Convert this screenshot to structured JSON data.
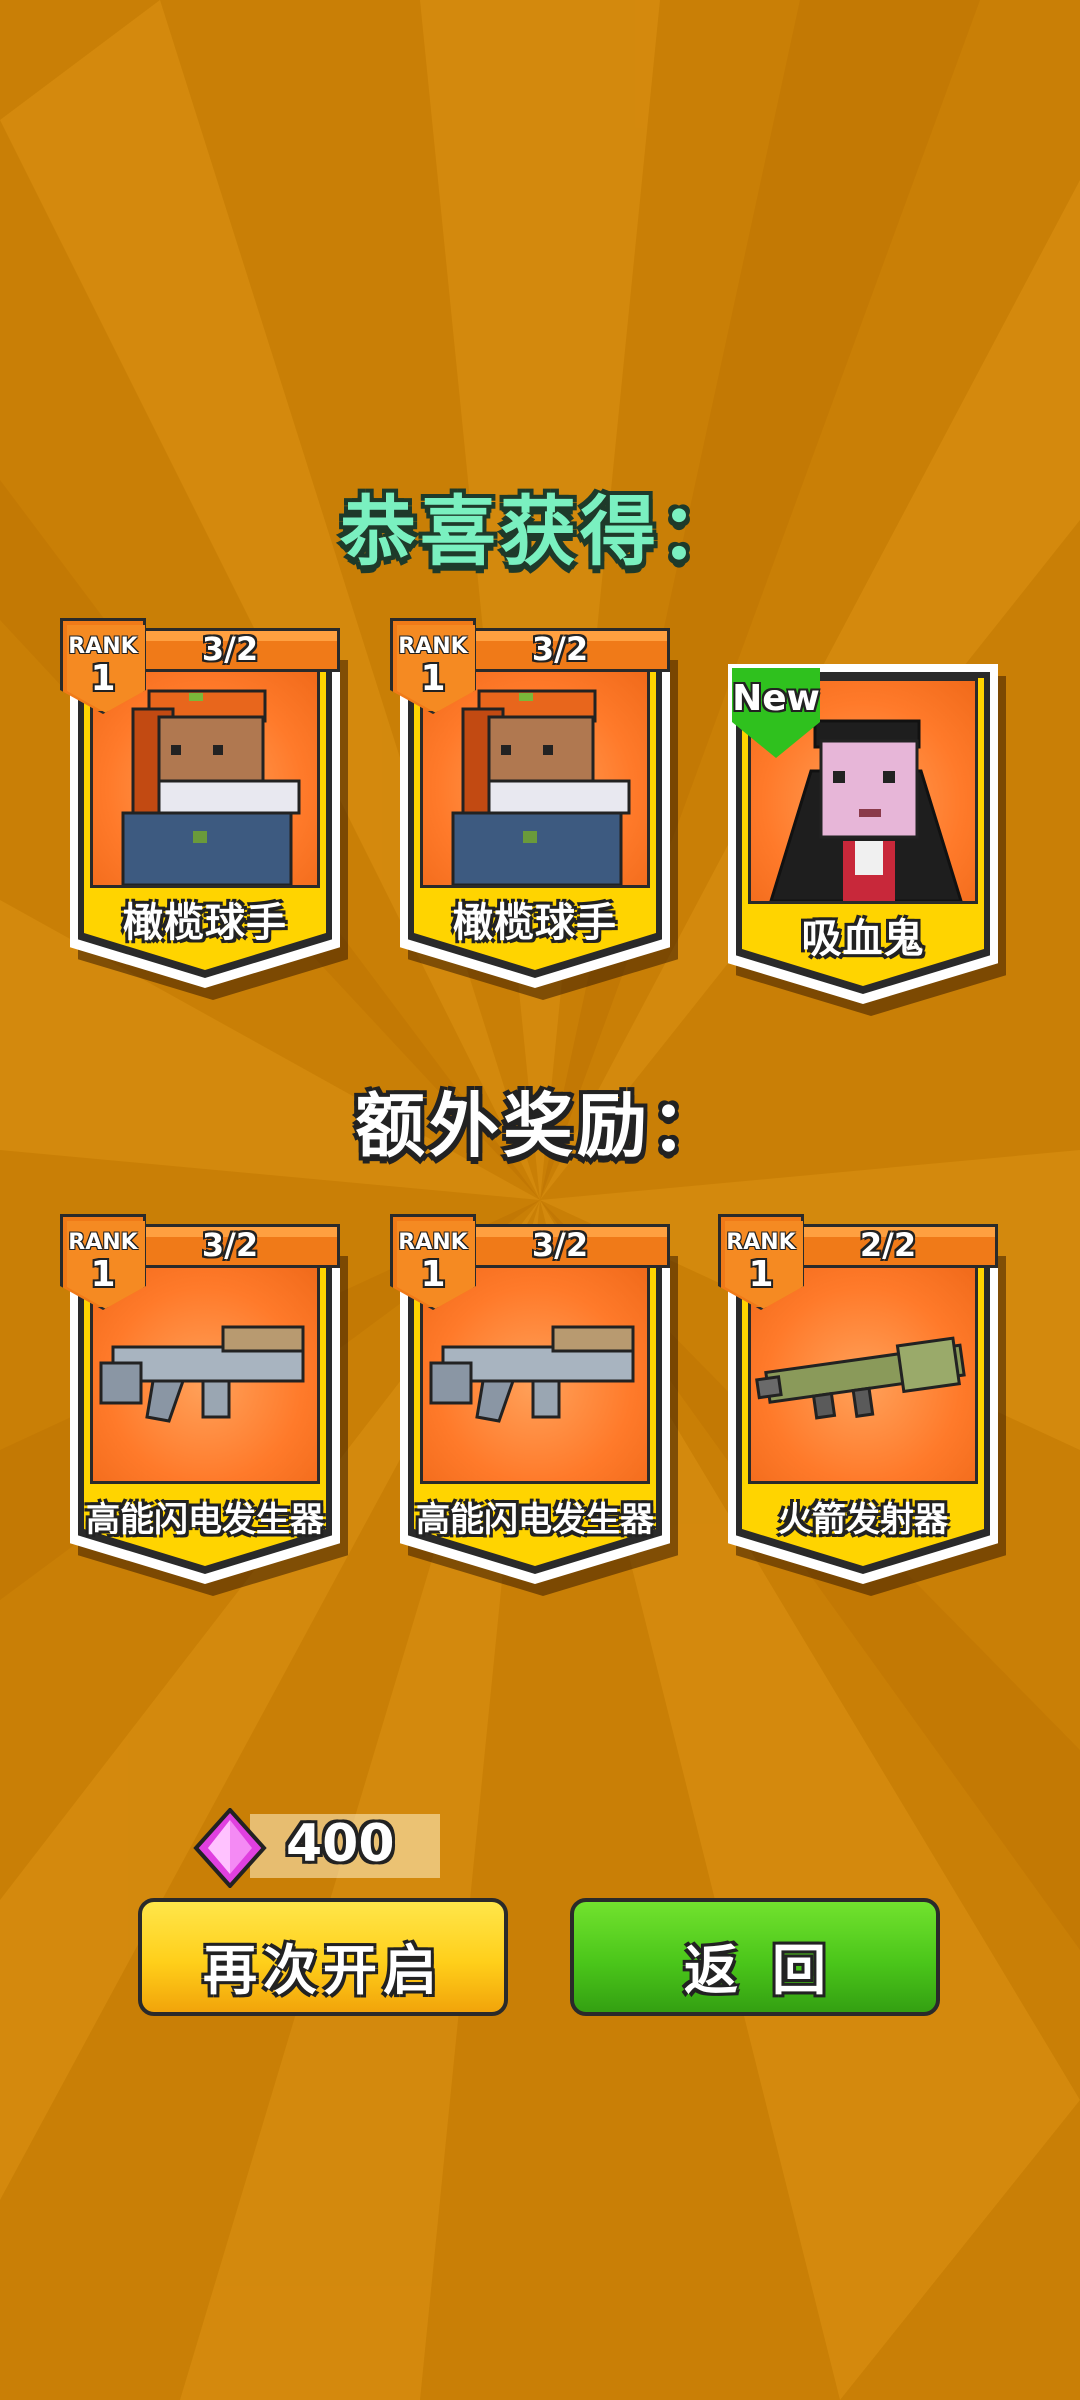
{
  "header": {
    "title": "恭喜获得："
  },
  "bonus": {
    "title": "额外奖励："
  },
  "rewards": [
    {
      "rank_label": "RANK",
      "rank": "1",
      "count": "3/2",
      "name": "橄榄球手",
      "is_new": false
    },
    {
      "rank_label": "RANK",
      "rank": "1",
      "count": "3/2",
      "name": "橄榄球手",
      "is_new": false
    },
    {
      "name": "吸血鬼",
      "is_new": true,
      "new_label": "New"
    }
  ],
  "bonus_rewards": [
    {
      "rank_label": "RANK",
      "rank": "1",
      "count": "3/2",
      "name": "高能闪电发生器"
    },
    {
      "rank_label": "RANK",
      "rank": "1",
      "count": "3/2",
      "name": "高能闪电发生器"
    },
    {
      "rank_label": "RANK",
      "rank": "1",
      "count": "2/2",
      "name": "火箭发射器"
    }
  ],
  "currency": {
    "amount": "400",
    "icon": "gem-icon",
    "color": "#e040e0"
  },
  "buttons": {
    "reopen": "再次开启",
    "back": "返回"
  },
  "colors": {
    "background": "#c97f06",
    "card_orange": "#f07a18",
    "card_yellow": "#ffd400",
    "title_teal": "#7af0c0",
    "button_yellow": "#ffcf1a",
    "button_green": "#4bc61a"
  }
}
